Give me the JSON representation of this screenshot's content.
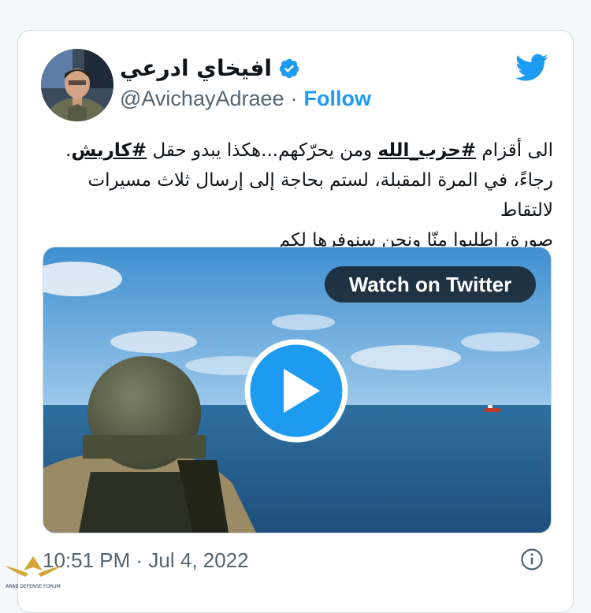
{
  "author": {
    "display_name": "افيخاي ادرعي",
    "handle": "@AvichayAdraee",
    "separator": "·",
    "follow_label": "Follow"
  },
  "tweet": {
    "line1_part1": "الى أقزام ",
    "hashtag1": "#حزب_الله",
    "line1_part2": " ومن يحرّكهم...هكذا يبدو حقل ",
    "hashtag2": "#كاريش",
    "line1_part3": ".",
    "line2": "رجاءً، في المرة المقبلة، لستم بحاجة إلى إرسال ثلاث مسيرات لالتقاط",
    "line3": "صورة، إطلبوا منّا ونحن سنوفرها لكم"
  },
  "media": {
    "watch_label": "Watch on Twitter"
  },
  "footer": {
    "timestamp": "10:51 PM · Jul 4, 2022"
  },
  "watermark": {
    "text": "DA ARAB DEFENSE FORUM"
  },
  "colors": {
    "brand": "#1d9bf0",
    "text": "#0f1419",
    "muted": "#536471"
  }
}
